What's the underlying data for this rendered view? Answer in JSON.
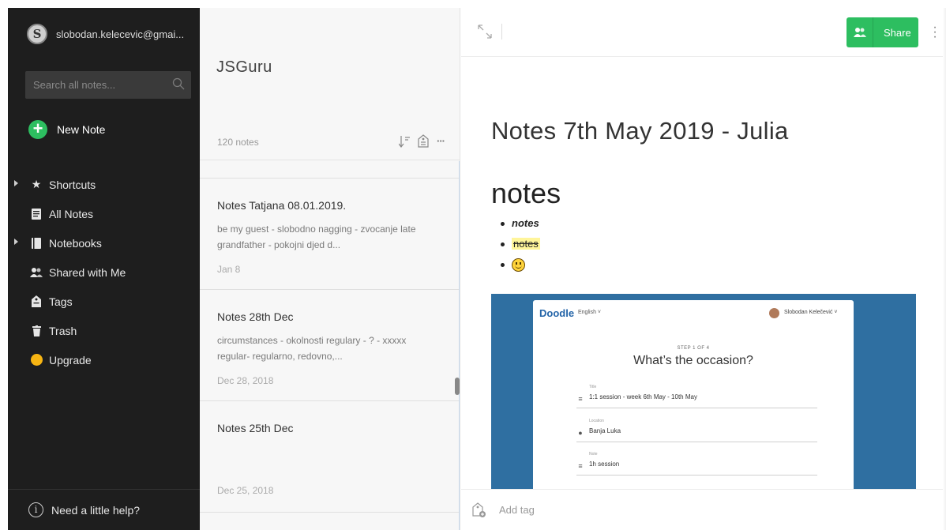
{
  "sidebar": {
    "account_email": "slobodan.kelecevic@gmai...",
    "search_placeholder": "Search all notes...",
    "new_note_label": "New Note",
    "items": [
      {
        "label": "Shortcuts",
        "icon": "star-icon",
        "has_arrow": true
      },
      {
        "label": "All Notes",
        "icon": "note-icon",
        "has_arrow": false
      },
      {
        "label": "Notebooks",
        "icon": "notebook-icon",
        "has_arrow": true
      },
      {
        "label": "Shared with Me",
        "icon": "people-icon",
        "has_arrow": false
      },
      {
        "label": "Tags",
        "icon": "tag-icon",
        "has_arrow": false
      },
      {
        "label": "Trash",
        "icon": "trash-icon",
        "has_arrow": false
      },
      {
        "label": "Upgrade",
        "icon": "upgrade-icon",
        "has_arrow": false
      }
    ],
    "help_label": "Need a little help?"
  },
  "notelist": {
    "notebook_title": "JSGuru",
    "notes_count": "120 notes",
    "cards": [
      {
        "title": "Notes Tatjana 08.01.2019.",
        "snippet": "be my guest - slobodno nagging - zvocanje late grandfather - pokojni djed d...",
        "date": "Jan 8"
      },
      {
        "title": "Notes 28th Dec",
        "snippet": "circumstances - okolnosti regulary - ? - xxxxx regular- regularno, redovno,...",
        "date": "Dec 28, 2018"
      },
      {
        "title": "Notes 25th Dec",
        "snippet": "",
        "date": "Dec 25, 2018"
      }
    ]
  },
  "editor": {
    "share_label": "Share",
    "note_title": "Notes 7th May 2019 - Julia",
    "heading": "notes",
    "bullets": [
      "notes",
      "notes"
    ],
    "tag_placeholder": "Add tag",
    "doodle": {
      "logo": "Doodle",
      "language": "English ˅",
      "user": "Slobodan Kelečević ˅",
      "step": "STEP 1 OF 4",
      "question": "What’s the occasion?",
      "fields": [
        {
          "label": "Title",
          "value": "1:1 session - week 6th May - 10th May"
        },
        {
          "label": "Location",
          "value": "Banja Luka"
        },
        {
          "label": "Note",
          "value": "1h session"
        }
      ]
    }
  },
  "colors": {
    "accent_green": "#2dbe60",
    "sidebar_bg": "#1e1e1e",
    "upgrade_yellow": "#f7b513",
    "doodle_blue": "#2f6fa1"
  }
}
